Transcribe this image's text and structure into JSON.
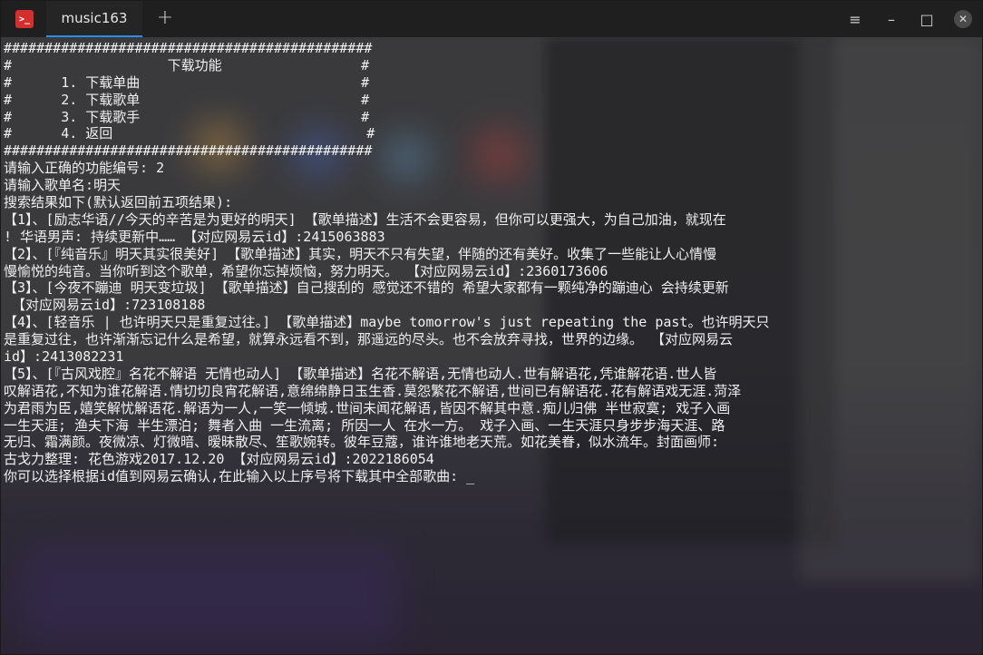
{
  "window": {
    "tab_title": "music163",
    "add_tab_symbol": "+",
    "menu_symbol": "≡",
    "minimize_symbol": "–",
    "maximize_symbol": "□",
    "close_symbol": "✕"
  },
  "terminal": {
    "lines": [
      "#############################################",
      "#                   下载功能                 #",
      "#      1. 下载单曲                           #",
      "#      2. 下载歌单                           #",
      "#      3. 下载歌手                           #",
      "#      4. 返回                               #",
      "#############################################",
      "请输入正确的功能编号: 2",
      "请输入歌单名:明天",
      "搜索结果如下(默认返回前五项结果):",
      "【1】、[励志华语//今天的辛苦是为更好的明天] 【歌单描述】生活不会更容易，但你可以更强大，为自己加油，就现在",
      "! 华语男声: 持续更新中…… 【对应网易云id】:2415063883",
      "【2】、[『纯音乐』明天其实很美好] 【歌单描述】其实，明天不只有失望，伴随的还有美好。收集了一些能让人心情慢",
      "慢愉悦的纯音。当你听到这个歌单，希望你忘掉烦恼，努力明天。 【对应网易云id】:2360173606",
      "【3】、[今夜不蹦迪 明天变垃圾] 【歌单描述】自己搜刮的 感觉还不错的 希望大家都有一颗纯净的蹦迪心 会持续更新",
      " 【对应网易云id】:723108188",
      "【4】、[轻音乐 | 也许明天只是重复过往。] 【歌单描述】maybe tomorrow's just repeating the past。也许明天只",
      "是重复过往，也许渐渐忘记什么是希望，就算永远看不到，那遥远的尽头。也不会放弃寻找，世界的边缘。 【对应网易云",
      "id】:2413082231",
      "【5】、[『古风戏腔』名花不解语 无情也动人] 【歌单描述】名花不解语,无情也动人.世有解语花,凭谁解花语.世人皆",
      "叹解语花,不知为谁花解语.情切切良宵花解语,意绵绵静日玉生香.莫怨繁花不解语,世间已有解语花.花有解语戏无涯.菏泽",
      "为君雨为臣,嬉笑解忧解语花.解语为一人,一笑一倾城.世间未闻花解语,皆因不解其中意.痴儿归佛 半世寂寞; 戏子入画",
      "一生天涯; 渔夫下海 半生漂泊; 舞者入曲 一生流离; 所因一人 在水一方。 戏子入画、一生天涯只身步步海天涯、路",
      "无归、霜满颜。夜微凉、灯微暗、暧昧散尽、笙歌婉转。彼年豆蔻，谁许谁地老天荒。如花美眷，似水流年。封面画师:",
      "古戈力整理: 花色游戏2017.12.20 【对应网易云id】:2022186054",
      "你可以选择根据id值到网易云确认,在此输入以上序号将下载其中全部歌曲: "
    ],
    "cursor": "_"
  }
}
